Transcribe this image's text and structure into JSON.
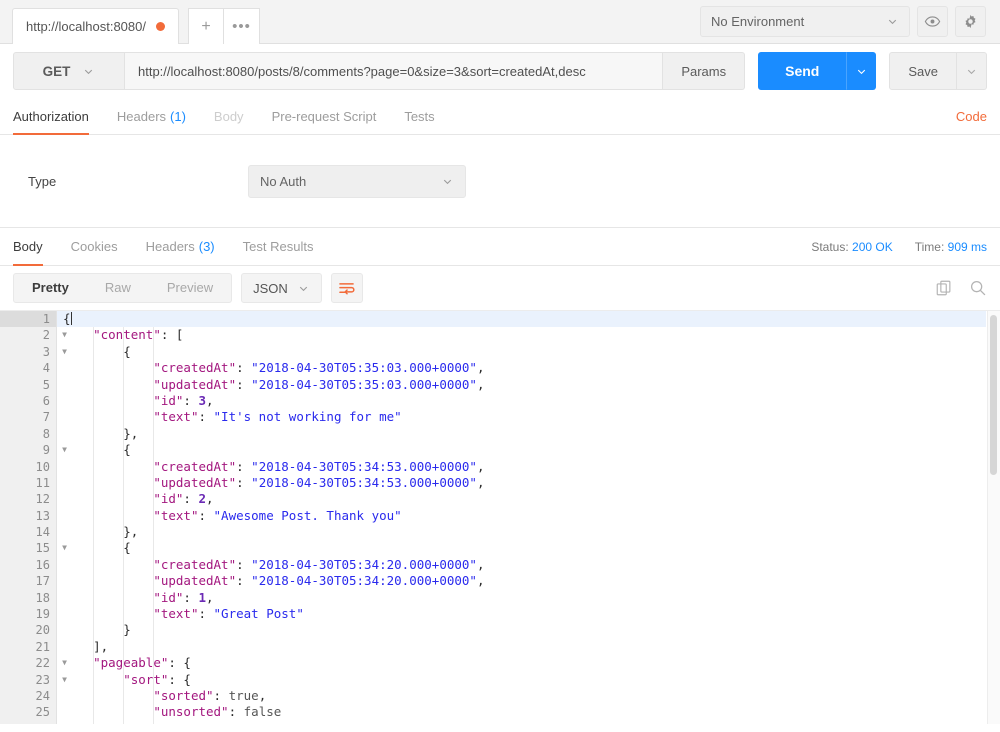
{
  "tabbar": {
    "request_tab_label": "http://localhost:8080/",
    "unsaved_indicator": "unsaved-dot",
    "new_tab_label": "+",
    "more_tabs_label": "•••",
    "environment_value": "No Environment",
    "eye_icon": "eye-icon",
    "settings_icon": "gear-icon"
  },
  "request": {
    "method": "GET",
    "url": "http://localhost:8080/posts/8/comments?page=0&size=3&sort=createdAt,desc",
    "params_label": "Params",
    "send_label": "Send",
    "save_label": "Save"
  },
  "request_tabs": {
    "items": [
      {
        "label": "Authorization",
        "count": "",
        "active": true,
        "disabled": false
      },
      {
        "label": "Headers",
        "count": "(1)",
        "active": false,
        "disabled": false
      },
      {
        "label": "Body",
        "count": "",
        "active": false,
        "disabled": true
      },
      {
        "label": "Pre-request Script",
        "count": "",
        "active": false,
        "disabled": false
      },
      {
        "label": "Tests",
        "count": "",
        "active": false,
        "disabled": false
      }
    ],
    "code_link": "Code"
  },
  "auth": {
    "type_label": "Type",
    "type_value": "No Auth"
  },
  "response_tabs": {
    "items": [
      {
        "label": "Body",
        "count": "",
        "active": true
      },
      {
        "label": "Cookies",
        "count": "",
        "active": false
      },
      {
        "label": "Headers",
        "count": "(3)",
        "active": false
      },
      {
        "label": "Test Results",
        "count": "",
        "active": false
      }
    ],
    "status_label": "Status:",
    "status_value": "200 OK",
    "time_label": "Time:",
    "time_value": "909 ms"
  },
  "body_toolbar": {
    "view_modes": [
      {
        "label": "Pretty",
        "active": true
      },
      {
        "label": "Raw",
        "active": false
      },
      {
        "label": "Preview",
        "active": false
      }
    ],
    "format_value": "JSON",
    "wrap_icon": "word-wrap-icon",
    "copy_icon": "copy-icon",
    "search_icon": "search-icon"
  },
  "colors": {
    "accent_orange": "#f26b3a",
    "accent_blue": "#1a8cff",
    "json_key": "#a3177f",
    "json_string": "#2a2aed",
    "json_number": "#6b2ab5"
  },
  "response_body": {
    "language": "json",
    "highlighted_line": 1,
    "lines": [
      {
        "n": 1,
        "fold": true,
        "indent": 0,
        "tokens": [
          {
            "t": "p",
            "v": "{"
          }
        ],
        "cursor": true
      },
      {
        "n": 2,
        "fold": true,
        "indent": 1,
        "tokens": [
          {
            "t": "k",
            "v": "\"content\""
          },
          {
            "t": "p",
            "v": ": ["
          }
        ]
      },
      {
        "n": 3,
        "fold": true,
        "indent": 2,
        "tokens": [
          {
            "t": "p",
            "v": "{"
          }
        ]
      },
      {
        "n": 4,
        "fold": false,
        "indent": 3,
        "tokens": [
          {
            "t": "k",
            "v": "\"createdAt\""
          },
          {
            "t": "p",
            "v": ": "
          },
          {
            "t": "s",
            "v": "\"2018-04-30T05:35:03.000+0000\""
          },
          {
            "t": "p",
            "v": ","
          }
        ]
      },
      {
        "n": 5,
        "fold": false,
        "indent": 3,
        "tokens": [
          {
            "t": "k",
            "v": "\"updatedAt\""
          },
          {
            "t": "p",
            "v": ": "
          },
          {
            "t": "s",
            "v": "\"2018-04-30T05:35:03.000+0000\""
          },
          {
            "t": "p",
            "v": ","
          }
        ]
      },
      {
        "n": 6,
        "fold": false,
        "indent": 3,
        "tokens": [
          {
            "t": "k",
            "v": "\"id\""
          },
          {
            "t": "p",
            "v": ": "
          },
          {
            "t": "n",
            "v": "3"
          },
          {
            "t": "p",
            "v": ","
          }
        ]
      },
      {
        "n": 7,
        "fold": false,
        "indent": 3,
        "tokens": [
          {
            "t": "k",
            "v": "\"text\""
          },
          {
            "t": "p",
            "v": ": "
          },
          {
            "t": "s",
            "v": "\"It's not working for me\""
          }
        ]
      },
      {
        "n": 8,
        "fold": false,
        "indent": 2,
        "tokens": [
          {
            "t": "p",
            "v": "},"
          }
        ]
      },
      {
        "n": 9,
        "fold": true,
        "indent": 2,
        "tokens": [
          {
            "t": "p",
            "v": "{"
          }
        ]
      },
      {
        "n": 10,
        "fold": false,
        "indent": 3,
        "tokens": [
          {
            "t": "k",
            "v": "\"createdAt\""
          },
          {
            "t": "p",
            "v": ": "
          },
          {
            "t": "s",
            "v": "\"2018-04-30T05:34:53.000+0000\""
          },
          {
            "t": "p",
            "v": ","
          }
        ]
      },
      {
        "n": 11,
        "fold": false,
        "indent": 3,
        "tokens": [
          {
            "t": "k",
            "v": "\"updatedAt\""
          },
          {
            "t": "p",
            "v": ": "
          },
          {
            "t": "s",
            "v": "\"2018-04-30T05:34:53.000+0000\""
          },
          {
            "t": "p",
            "v": ","
          }
        ]
      },
      {
        "n": 12,
        "fold": false,
        "indent": 3,
        "tokens": [
          {
            "t": "k",
            "v": "\"id\""
          },
          {
            "t": "p",
            "v": ": "
          },
          {
            "t": "n",
            "v": "2"
          },
          {
            "t": "p",
            "v": ","
          }
        ]
      },
      {
        "n": 13,
        "fold": false,
        "indent": 3,
        "tokens": [
          {
            "t": "k",
            "v": "\"text\""
          },
          {
            "t": "p",
            "v": ": "
          },
          {
            "t": "s",
            "v": "\"Awesome Post. Thank you\""
          }
        ]
      },
      {
        "n": 14,
        "fold": false,
        "indent": 2,
        "tokens": [
          {
            "t": "p",
            "v": "},"
          }
        ]
      },
      {
        "n": 15,
        "fold": true,
        "indent": 2,
        "tokens": [
          {
            "t": "p",
            "v": "{"
          }
        ]
      },
      {
        "n": 16,
        "fold": false,
        "indent": 3,
        "tokens": [
          {
            "t": "k",
            "v": "\"createdAt\""
          },
          {
            "t": "p",
            "v": ": "
          },
          {
            "t": "s",
            "v": "\"2018-04-30T05:34:20.000+0000\""
          },
          {
            "t": "p",
            "v": ","
          }
        ]
      },
      {
        "n": 17,
        "fold": false,
        "indent": 3,
        "tokens": [
          {
            "t": "k",
            "v": "\"updatedAt\""
          },
          {
            "t": "p",
            "v": ": "
          },
          {
            "t": "s",
            "v": "\"2018-04-30T05:34:20.000+0000\""
          },
          {
            "t": "p",
            "v": ","
          }
        ]
      },
      {
        "n": 18,
        "fold": false,
        "indent": 3,
        "tokens": [
          {
            "t": "k",
            "v": "\"id\""
          },
          {
            "t": "p",
            "v": ": "
          },
          {
            "t": "n",
            "v": "1"
          },
          {
            "t": "p",
            "v": ","
          }
        ]
      },
      {
        "n": 19,
        "fold": false,
        "indent": 3,
        "tokens": [
          {
            "t": "k",
            "v": "\"text\""
          },
          {
            "t": "p",
            "v": ": "
          },
          {
            "t": "s",
            "v": "\"Great Post\""
          }
        ]
      },
      {
        "n": 20,
        "fold": false,
        "indent": 2,
        "tokens": [
          {
            "t": "p",
            "v": "}"
          }
        ]
      },
      {
        "n": 21,
        "fold": false,
        "indent": 1,
        "tokens": [
          {
            "t": "p",
            "v": "],"
          }
        ]
      },
      {
        "n": 22,
        "fold": true,
        "indent": 1,
        "tokens": [
          {
            "t": "k",
            "v": "\"pageable\""
          },
          {
            "t": "p",
            "v": ": {"
          }
        ]
      },
      {
        "n": 23,
        "fold": true,
        "indent": 2,
        "tokens": [
          {
            "t": "k",
            "v": "\"sort\""
          },
          {
            "t": "p",
            "v": ": {"
          }
        ]
      },
      {
        "n": 24,
        "fold": false,
        "indent": 3,
        "tokens": [
          {
            "t": "k",
            "v": "\"sorted\""
          },
          {
            "t": "p",
            "v": ": "
          },
          {
            "t": "b",
            "v": "true"
          },
          {
            "t": "p",
            "v": ","
          }
        ]
      },
      {
        "n": 25,
        "fold": false,
        "indent": 3,
        "tokens": [
          {
            "t": "k",
            "v": "\"unsorted\""
          },
          {
            "t": "p",
            "v": ": "
          },
          {
            "t": "b",
            "v": "false"
          }
        ]
      }
    ]
  }
}
